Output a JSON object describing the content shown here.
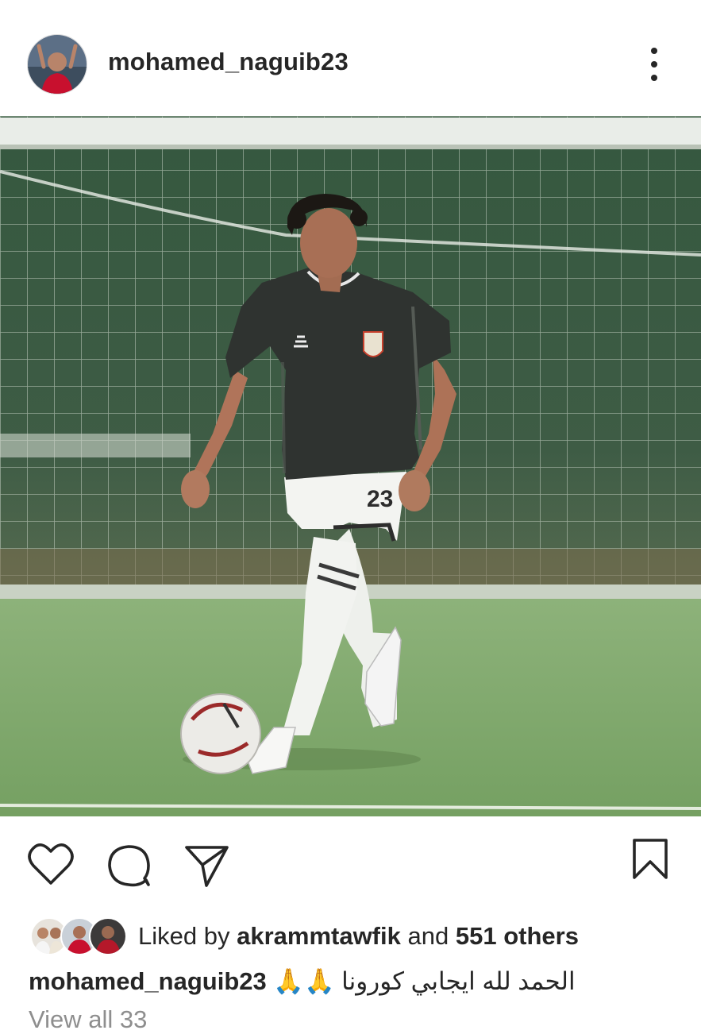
{
  "post": {
    "username": "mohamed_naguib23",
    "image_alt": "Football player in dark kit number 23 dribbling a ball on a pitch",
    "jersey_number": "23",
    "likes_prefix": "Liked by",
    "liked_by_user": "akrammtawfik",
    "likes_connector": "and",
    "likes_others": "551 others",
    "caption_username": "mohamed_naguib23",
    "caption_text": "الحمد لله ايجابي كورونا 🙏🙏",
    "view_comments_partial": "View all 33"
  },
  "icons": {
    "more": "more-vertical-icon",
    "like": "heart-icon",
    "comment": "comment-icon",
    "share": "send-icon",
    "save": "bookmark-icon"
  },
  "colors": {
    "text": "#262626",
    "muted": "#8e8e8e",
    "pitch": "#7fa86a",
    "kit": "#2f3330"
  }
}
